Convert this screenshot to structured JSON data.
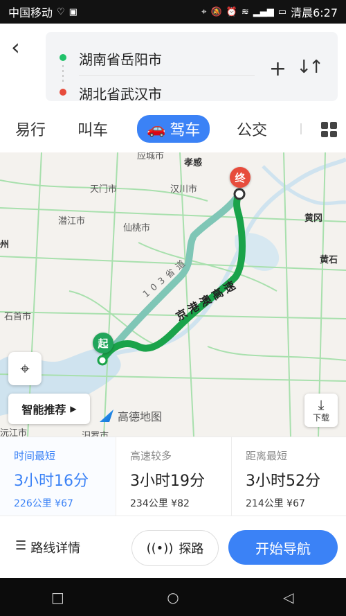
{
  "status": {
    "carrier": "中国移动",
    "right_text": "清晨6:27"
  },
  "route": {
    "from": "湖南省岳阳市",
    "to": "湖北省武汉市"
  },
  "tabs": [
    "易行",
    "叫车",
    "驾车",
    "公交"
  ],
  "active_tab": "驾车",
  "map": {
    "labels": {
      "xiaogan": "孝感",
      "tianmen": "天门市",
      "hanchuan": "汉川市",
      "qianjiang": "潜江市",
      "xiantao": "仙桃市",
      "huanggang": "黄冈",
      "huangshi": "黄石",
      "shishou": "石首市",
      "route_1": "103省道",
      "route_2": "京港澳高速",
      "top_cut": "应城市",
      "left_cut": "州",
      "bottom_cut1": "沅江市",
      "bottom_cut2": "汨罗市"
    },
    "start_marker": "起",
    "end_marker": "终",
    "smart_label": "智能推荐",
    "logo_text": "高德地图",
    "download_label": "下载",
    "colors": {
      "route_primary": "#1aa34a",
      "route_secondary": "#7fc6b6",
      "accent": "#3b82f6"
    }
  },
  "options": [
    {
      "title": "时间最短",
      "duration": "3小时16分",
      "meta": "226公里 ¥67",
      "selected": true
    },
    {
      "title": "高速较多",
      "duration": "3小时19分",
      "meta": "234公里 ¥82",
      "selected": false
    },
    {
      "title": "距离最短",
      "duration": "3小时52分",
      "meta": "214公里 ¥67",
      "selected": false
    }
  ],
  "actions": {
    "details": "路线详情",
    "explore": "探路",
    "start": "开始导航"
  }
}
